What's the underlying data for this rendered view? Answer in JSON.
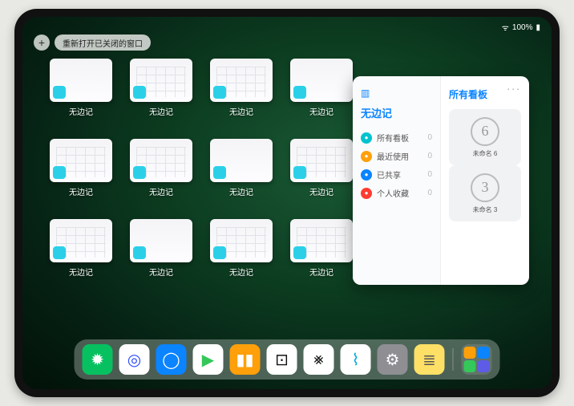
{
  "status": {
    "time": "",
    "battery_label": "100%"
  },
  "top_controls": {
    "plus_label": "+",
    "reopen_label": "重新打开已关闭的窗口"
  },
  "windows": [
    {
      "label": "无边记",
      "variant": "blank"
    },
    {
      "label": "无边记",
      "variant": "grid"
    },
    {
      "label": "无边记",
      "variant": "grid"
    },
    {
      "label": "无边记",
      "variant": "blank"
    },
    {
      "label": "无边记",
      "variant": "grid"
    },
    {
      "label": "无边记",
      "variant": "grid"
    },
    {
      "label": "无边记",
      "variant": "blank"
    },
    {
      "label": "无边记",
      "variant": "grid"
    },
    {
      "label": "无边记",
      "variant": "grid"
    },
    {
      "label": "无边记",
      "variant": "blank"
    },
    {
      "label": "无边记",
      "variant": "grid"
    },
    {
      "label": "无边记",
      "variant": "grid"
    }
  ],
  "main_window": {
    "sidebar_title": "无边记",
    "items": [
      {
        "icon_name": "grid-icon",
        "color": "#00c3d0",
        "label": "所有看板",
        "count": 0
      },
      {
        "icon_name": "clock-icon",
        "color": "#ff9f0a",
        "label": "最近使用",
        "count": 0
      },
      {
        "icon_name": "people-icon",
        "color": "#0a84ff",
        "label": "已共享",
        "count": 0
      },
      {
        "icon_name": "heart-icon",
        "color": "#ff3b30",
        "label": "个人收藏",
        "count": 0
      }
    ],
    "right_title": "所有看板",
    "boards": [
      {
        "glyph": "6",
        "label": "未命名 6"
      },
      {
        "glyph": "3",
        "label": "未命名 3"
      }
    ],
    "menu_label": "..."
  },
  "dock": {
    "apps": [
      {
        "name": "wechat-icon",
        "bg": "#07c160",
        "glyph": "✹"
      },
      {
        "name": "quark-icon",
        "bg": "#ffffff",
        "fg": "#2b4bff",
        "glyph": "◎"
      },
      {
        "name": "browser-icon",
        "bg": "#0a84ff",
        "glyph": "◯"
      },
      {
        "name": "play-icon",
        "bg": "#ffffff",
        "fg": "#34c759",
        "glyph": "▶"
      },
      {
        "name": "books-icon",
        "bg": "#ff9f0a",
        "glyph": "▮▮"
      },
      {
        "name": "dice-icon",
        "bg": "#ffffff",
        "fg": "#111",
        "glyph": "⊡"
      },
      {
        "name": "connect-icon",
        "bg": "#ffffff",
        "fg": "#111",
        "glyph": "⨳"
      },
      {
        "name": "freeform-icon",
        "bg": "#ffffff",
        "fg": "#0ad",
        "glyph": "⌇"
      },
      {
        "name": "settings-icon",
        "bg": "#8e8e93",
        "glyph": "⚙"
      },
      {
        "name": "notes-icon",
        "bg": "#ffe066",
        "fg": "#555",
        "glyph": "≣"
      }
    ]
  }
}
